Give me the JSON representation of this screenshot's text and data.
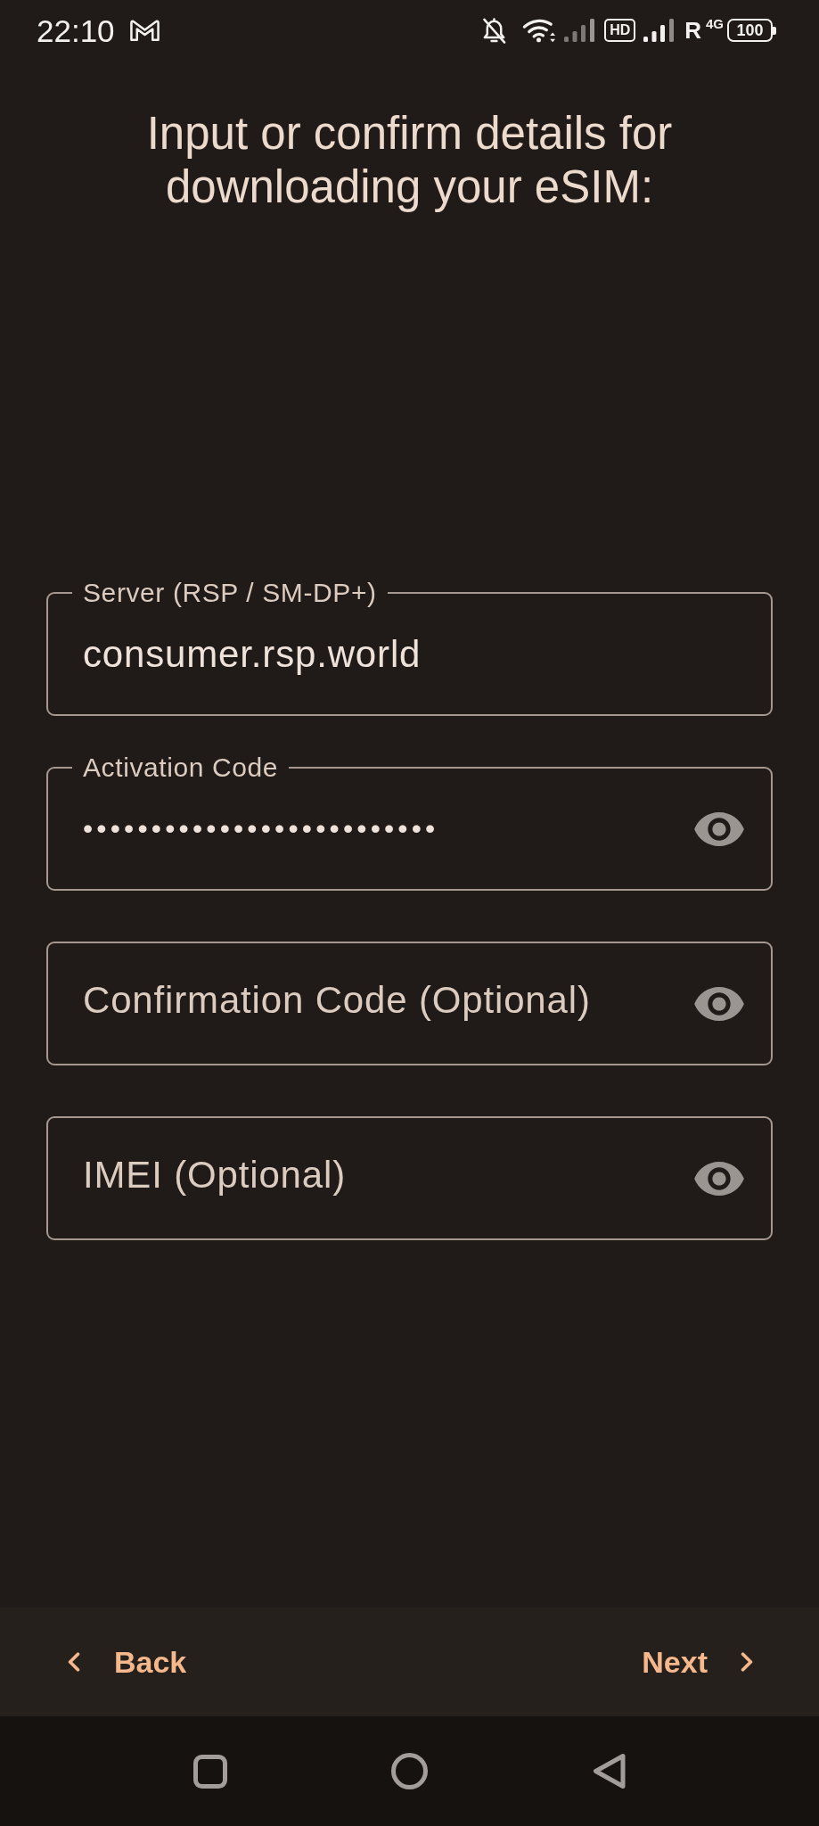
{
  "status_bar": {
    "time": "22:10",
    "hd": "HD",
    "roaming": "R",
    "network": "4G",
    "battery": "100"
  },
  "title": "Input or confirm details for downloading your eSIM:",
  "fields": [
    {
      "kind": "plain",
      "label": "Server (RSP / SM-DP+)",
      "value": "consumer.rsp.world"
    },
    {
      "kind": "secret",
      "label": "Activation Code",
      "value": "••••••••••••••••••••••••••"
    },
    {
      "kind": "secret",
      "placeholder": "Confirmation Code (Optional)"
    },
    {
      "kind": "secret",
      "placeholder": "IMEI (Optional)"
    }
  ],
  "footer": {
    "back": "Back",
    "next": "Next"
  }
}
